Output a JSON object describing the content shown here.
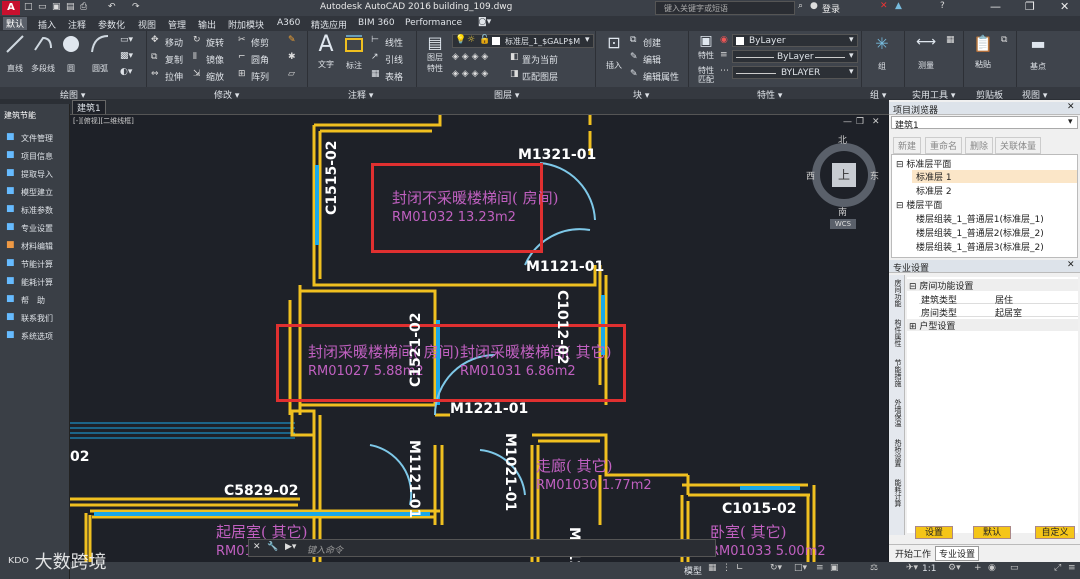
{
  "window": {
    "app_title": "Autodesk AutoCAD 2016",
    "file_name": "building_109.dwg",
    "search_placeholder": "键入关键字或短语",
    "login_label": "登录"
  },
  "menu": [
    "默认",
    "插入",
    "注释",
    "参数化",
    "视图",
    "管理",
    "输出",
    "附加模块",
    "A360",
    "精选应用",
    "BIM 360",
    "Performance"
  ],
  "ribbon": {
    "draw_tools": [
      "直线",
      "多段线",
      "圆",
      "圆弧"
    ],
    "modify_tools": [
      [
        "移动",
        "旋转",
        "修剪"
      ],
      [
        "复制",
        "镜像",
        "圆角"
      ],
      [
        "拉伸",
        "缩放",
        "阵列"
      ]
    ],
    "annotation_tools": [
      "文字",
      "标注"
    ],
    "annotation_sub": [
      "线性",
      "引线",
      "表格"
    ],
    "layer_props": "图层\n特性",
    "layer_name": "标准层_1_$GALP$M",
    "layer_actions": [
      "置为当前",
      "匹配图层"
    ],
    "insert_label": "插入",
    "block_actions": [
      "创建",
      "编辑",
      "编辑属性"
    ],
    "properties_label": "特性",
    "match_label": "特性\n匹配",
    "bylayer1": "ByLayer",
    "bylayer2": "ByLayer",
    "bylayer3": "BYLAYER",
    "group_label": "组",
    "measure_label": "测量",
    "paste_label": "粘贴",
    "base_label": "基点",
    "panel_labels": [
      "绘图 ▾",
      "修改 ▾",
      "注释 ▾",
      "图层 ▾",
      "块 ▾",
      "特性 ▾",
      "组 ▾",
      "实用工具 ▾",
      "剪贴板",
      "视图 ▾"
    ]
  },
  "doc_tab": "建筑1",
  "viewport_label": "[-][俯视][二维线框]",
  "left_panel": {
    "title": "建筑节能",
    "items": [
      "文件管理",
      "项目信息",
      "提取导入",
      "模型建立",
      "标准参数",
      "专业设置",
      "材料编辑",
      "节能计算",
      "能耗计算",
      "帮　助",
      "联系我们",
      "系统选项"
    ]
  },
  "compass": {
    "n": "北",
    "s": "南",
    "e": "东",
    "w": "西",
    "center": "上",
    "wcs": "WCS"
  },
  "drawing": {
    "rooms": [
      {
        "name": "封闭不采暖楼梯间( 房间)",
        "id": "RM01032",
        "area": "13.23m2"
      },
      {
        "name": "封闭采暖楼梯间( 房间)",
        "id": "RM01027",
        "area": "5.88m2"
      },
      {
        "name": "封闭采暖楼梯间( 其它)",
        "id": "RM01031",
        "area": "6.86m2"
      },
      {
        "name": "走廊( 其它)",
        "id": "RM01030",
        "area": "1.77m2"
      },
      {
        "name": "起居室( 其它)",
        "id": "RM01026",
        "area": ""
      },
      {
        "name": "卧室( 其它)",
        "id": "RM01033",
        "area": "5.00m2"
      }
    ],
    "labels": {
      "m1321": "M1321-01",
      "c1515": "C1515-02",
      "m1121a": "M1121-01",
      "c1012": "C1012-02",
      "c1521": "C1521-02",
      "m1221": "M1221-01",
      "m1121b": "M1121-01",
      "m1021": "M1021-01",
      "c5829": "C5829-02",
      "c1015": "C1015-02",
      "c02": "02",
      "m1121c": "M1121-01"
    }
  },
  "project_browser": {
    "title": "项目浏览器",
    "dropdown": "建筑1",
    "buttons": [
      "新建",
      "重命名",
      "删除",
      "关联体量"
    ],
    "tree": [
      "标准层平面",
      "标准层 1",
      "标准层 2",
      "楼层平面",
      "楼层组装_1_普通层1(标准层_1)",
      "楼层组装_1_普通层2(标准层_2)",
      "楼层组装_1_普通层3(标准层_2)"
    ]
  },
  "pro_settings": {
    "title": "专业设置",
    "vertical_tabs": [
      "房间功能",
      "构件属性",
      "节能措施",
      "外墙保温",
      "热桥设置",
      "能耗计算"
    ],
    "group1": "房间功能设置",
    "rows": [
      [
        "建筑类型",
        "居住"
      ],
      [
        "房间类型",
        "起居室"
      ]
    ],
    "group2": "户型设置",
    "buttons": [
      "设置",
      "默认",
      "自定义"
    ],
    "tabs": [
      "开始工作",
      "专业设置"
    ]
  },
  "command": {
    "placeholder": "键入命令"
  },
  "status": {
    "model": "模型",
    "scale": "1:1"
  },
  "watermark": "大数跨境",
  "colors": {
    "wall": "#f0c020",
    "window": "#1aa8e8",
    "door": "#7ec8e8",
    "highlight": "#e03030",
    "roomtext": "#c060c0",
    "label": "#ffffff"
  }
}
